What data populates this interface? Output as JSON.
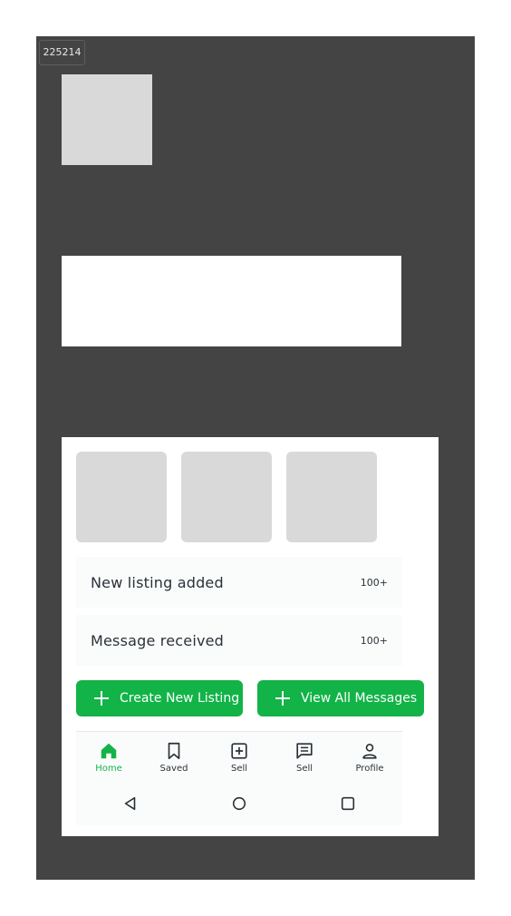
{
  "frame": {
    "id_label": "225214"
  },
  "notifications": [
    {
      "label": "New listing added",
      "count": "100+"
    },
    {
      "label": "Message received",
      "count": "100+"
    }
  ],
  "actions": {
    "create_label": "Create New Listing",
    "messages_label": "View All Messages"
  },
  "bottom_nav": {
    "items": [
      {
        "label": "Home",
        "icon": "home-icon",
        "active": true
      },
      {
        "label": "Saved",
        "icon": "bookmark-icon"
      },
      {
        "label": "Sell",
        "icon": "plus-square-icon"
      },
      {
        "label": "Sell",
        "icon": "chat-icon"
      },
      {
        "label": "Profile",
        "icon": "person-icon"
      }
    ]
  },
  "colors": {
    "accent": "#12b347",
    "frame_bg": "#444444",
    "placeholder": "#d9d9d9",
    "text": "#2a3137"
  }
}
